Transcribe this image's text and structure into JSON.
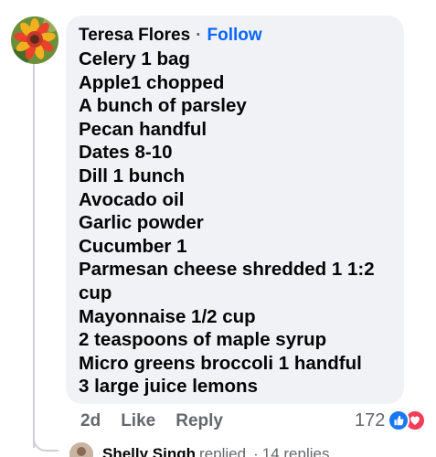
{
  "comment": {
    "author": "Teresa Flores",
    "separator": "·",
    "follow_label": "Follow",
    "lines": [
      "Celery 1 bag",
      "Apple1 chopped",
      "A bunch of parsley",
      "Pecan handful",
      "Dates 8-10",
      "Dill 1 bunch",
      "Avocado oil",
      "Garlic powder",
      "Cucumber 1",
      "Parmesan cheese shredded 1 1:2",
      "cup",
      "Mayonnaise 1/2 cup",
      "2 teaspoons of maple syrup",
      "Micro greens broccoli 1 handful",
      "3 large juice lemons"
    ]
  },
  "actions": {
    "time": "2d",
    "like_label": "Like",
    "reply_label": "Reply"
  },
  "reactions": {
    "count": "172",
    "icons": [
      "like-icon",
      "love-icon"
    ],
    "like_color": "#1877f2",
    "love_color": "#f33e58"
  },
  "reply_preview": {
    "name": "Shelly Singh",
    "text": "replied",
    "separator": "·",
    "count_text": "14 replies"
  },
  "colors": {
    "link": "#0866ff",
    "bubble": "#f0f2f5",
    "muted": "#65676b"
  }
}
